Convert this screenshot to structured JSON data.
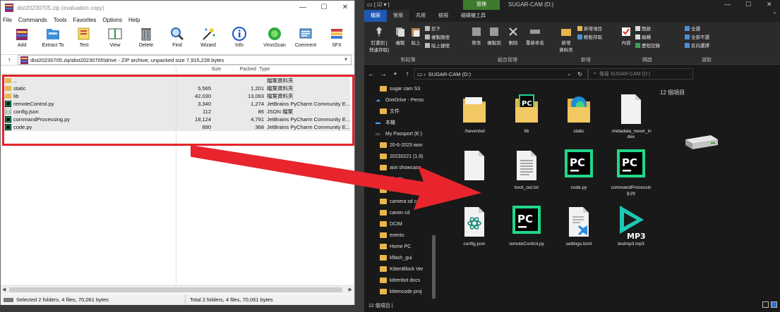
{
  "winrar": {
    "title": "dist20230705.zip (evaluation copy)",
    "menu": [
      "File",
      "Commands",
      "Tools",
      "Favorites",
      "Options",
      "Help"
    ],
    "toolbar": [
      "Add",
      "Extract To",
      "Test",
      "View",
      "Delete",
      "Find",
      "Wizard",
      "Info",
      "VirusScan",
      "Comment",
      "SFX"
    ],
    "path": "dist20230705.zip\\dist20230705\\drive - ZIP archive, unpacked size 7,915,228 bytes",
    "columns": {
      "size": "Size",
      "packed": "Packed",
      "type": "Type"
    },
    "rows": [
      {
        "name": "..",
        "size": "",
        "packed": "",
        "type": "檔案資料夾",
        "icon": "folder-icon"
      },
      {
        "name": "static",
        "size": "5,565",
        "packed": "1,201",
        "type": "檔案資料夾",
        "icon": "folder-icon"
      },
      {
        "name": "lib",
        "size": "42,030",
        "packed": "13,093",
        "type": "檔案資料夾",
        "icon": "folder-icon"
      },
      {
        "name": "remoteControl.py",
        "size": "3,340",
        "packed": "1,274",
        "type": "JetBrains PyCharm Community E...",
        "icon": "pycharm-file-icon"
      },
      {
        "name": "config.json",
        "size": "112",
        "packed": "86",
        "type": "JSON 檔案",
        "icon": "json-file-icon"
      },
      {
        "name": "commandProcessing.py",
        "size": "18,124",
        "packed": "4,791",
        "type": "JetBrains PyCharm Community E...",
        "icon": "pycharm-file-icon"
      },
      {
        "name": "code.py",
        "size": "890",
        "packed": "368",
        "type": "JetBrains PyCharm Community E...",
        "icon": "pycharm-file-icon"
      }
    ],
    "status_left": "Selected 2 folders, 4 files, 70,061 bytes",
    "status_right": "Total 2 folders, 4 files, 70,061 bytes"
  },
  "explorer": {
    "context_tab": "管理",
    "title": "SUGAR-CAM (D:)",
    "ribbon_tabs": [
      "檔案",
      "常用",
      "共用",
      "檢視",
      "磁碟機工具"
    ],
    "ribbon": {
      "pin": "釘選到 [\n快速存取]",
      "copy": "複製",
      "paste": "貼上",
      "cut": "剪下",
      "copy_path": "複製路徑",
      "paste_shortcut": "貼上捷徑",
      "clipboard_group": "剪貼簿",
      "move_to": "移至",
      "copy_to": "複製到",
      "delete": "刪除",
      "rename": "重新命名",
      "organize_group": "組合管理",
      "new_folder": "新增\n資料夾",
      "new_item": "新增項目",
      "easy_access": "輕鬆存取",
      "new_group": "新增",
      "properties": "內容",
      "open": "開啟",
      "edit": "編輯",
      "history": "歷程記錄",
      "open_group": "開啟",
      "select_all": "全選",
      "select_none": "全部不選",
      "invert_selection": "反向選擇",
      "select_group": "選取"
    },
    "address": "SUGAR-CAM (D:)",
    "search_placeholder": "搜尋 SUGAR-CAM (D:)",
    "nav_items": [
      {
        "label": "sugar cam S3",
        "kind": "folder"
      },
      {
        "label": "OneDrive - Perso",
        "kind": "cloud"
      },
      {
        "label": "文件",
        "kind": "folder"
      },
      {
        "label": "本機",
        "kind": "pc"
      },
      {
        "label": "My Passport (E:)",
        "kind": "drive"
      },
      {
        "label": "20-6-2023 won",
        "kind": "folder"
      },
      {
        "label": "20230221 (1.8)",
        "kind": "folder"
      },
      {
        "label": "aiot showcase",
        "kind": "folder"
      },
      {
        "label": "Alan's ...",
        "kind": "folder"
      },
      {
        "label": "Anson's file",
        "kind": "folder"
      },
      {
        "label": "camera sd card",
        "kind": "folder"
      },
      {
        "label": "canon cd",
        "kind": "folder"
      },
      {
        "label": "DCIM",
        "kind": "folder"
      },
      {
        "label": "events",
        "kind": "folder"
      },
      {
        "label": "Home PC",
        "kind": "folder"
      },
      {
        "label": "kflash_gui",
        "kind": "folder"
      },
      {
        "label": "KittenBlock Ver",
        "kind": "folder"
      },
      {
        "label": "kittenbot docs",
        "kind": "folder"
      },
      {
        "label": "kittencode proj",
        "kind": "folder"
      }
    ],
    "items": [
      {
        "label": ".fseventsd",
        "kind": "folder"
      },
      {
        "label": "lib",
        "kind": "folder-pc"
      },
      {
        "label": "static",
        "kind": "folder-edge"
      },
      {
        "label": ".metadata_never_index",
        "kind": "doc"
      },
      {
        "label": "",
        "kind": "doc"
      },
      {
        "label": "boot_out.txt",
        "kind": "txt"
      },
      {
        "label": "code.py",
        "kind": "pycharm"
      },
      {
        "label": "commandProcessing.py",
        "kind": "pycharm"
      },
      {
        "label": "config.json",
        "kind": "json"
      },
      {
        "label": "remoteControl.py",
        "kind": "pycharm"
      },
      {
        "label": "settings.toml",
        "kind": "vscode"
      },
      {
        "label": "testmp3.mp3",
        "kind": "mp3"
      }
    ],
    "item_count": "12 個項目",
    "status": "12 個項目  |"
  },
  "colors": {
    "highlight_red": "#e8242c",
    "folder_yellow": "#e8b64a",
    "pycharm_green": "#21d789",
    "file_tab_blue": "#1e58b4"
  }
}
